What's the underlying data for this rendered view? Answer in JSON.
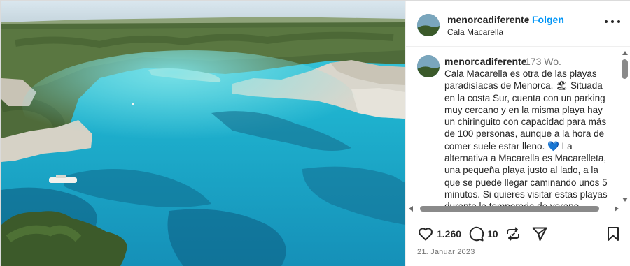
{
  "post": {
    "username": "menorcadiferente",
    "dot": "•",
    "follow_label": "Folgen",
    "location": "Cala Macarella"
  },
  "caption": {
    "username": "menorcadiferente",
    "age": "173 Wo.",
    "text": "Cala Macarella es otra de las playas paradisíacas de Menorca. 🏖 Situada en la costa Sur, cuenta con un parking muy cercano y en la misma playa hay un chiringuito con capacidad para más de 100 personas, aunque a la hora de comer suele estar lleno. 💙 La alternativa a Macarella es Macarelleta, una pequeña playa justo al lado, a la que se puede llegar caminando unos 5 minutos. Si quieres visitar estas playas durante la temporada de verano"
  },
  "actions": {
    "likes": "1.260",
    "comments": "10",
    "date": "21. Januar 2023"
  },
  "icons": {
    "more": "more-options-icon",
    "like": "heart-icon",
    "comment": "comment-icon",
    "repost": "repost-icon",
    "share": "share-icon",
    "save": "bookmark-icon"
  },
  "colors": {
    "accent": "#0095f6",
    "text": "#262626",
    "muted": "#737373",
    "sea": "#2aa7c4"
  }
}
